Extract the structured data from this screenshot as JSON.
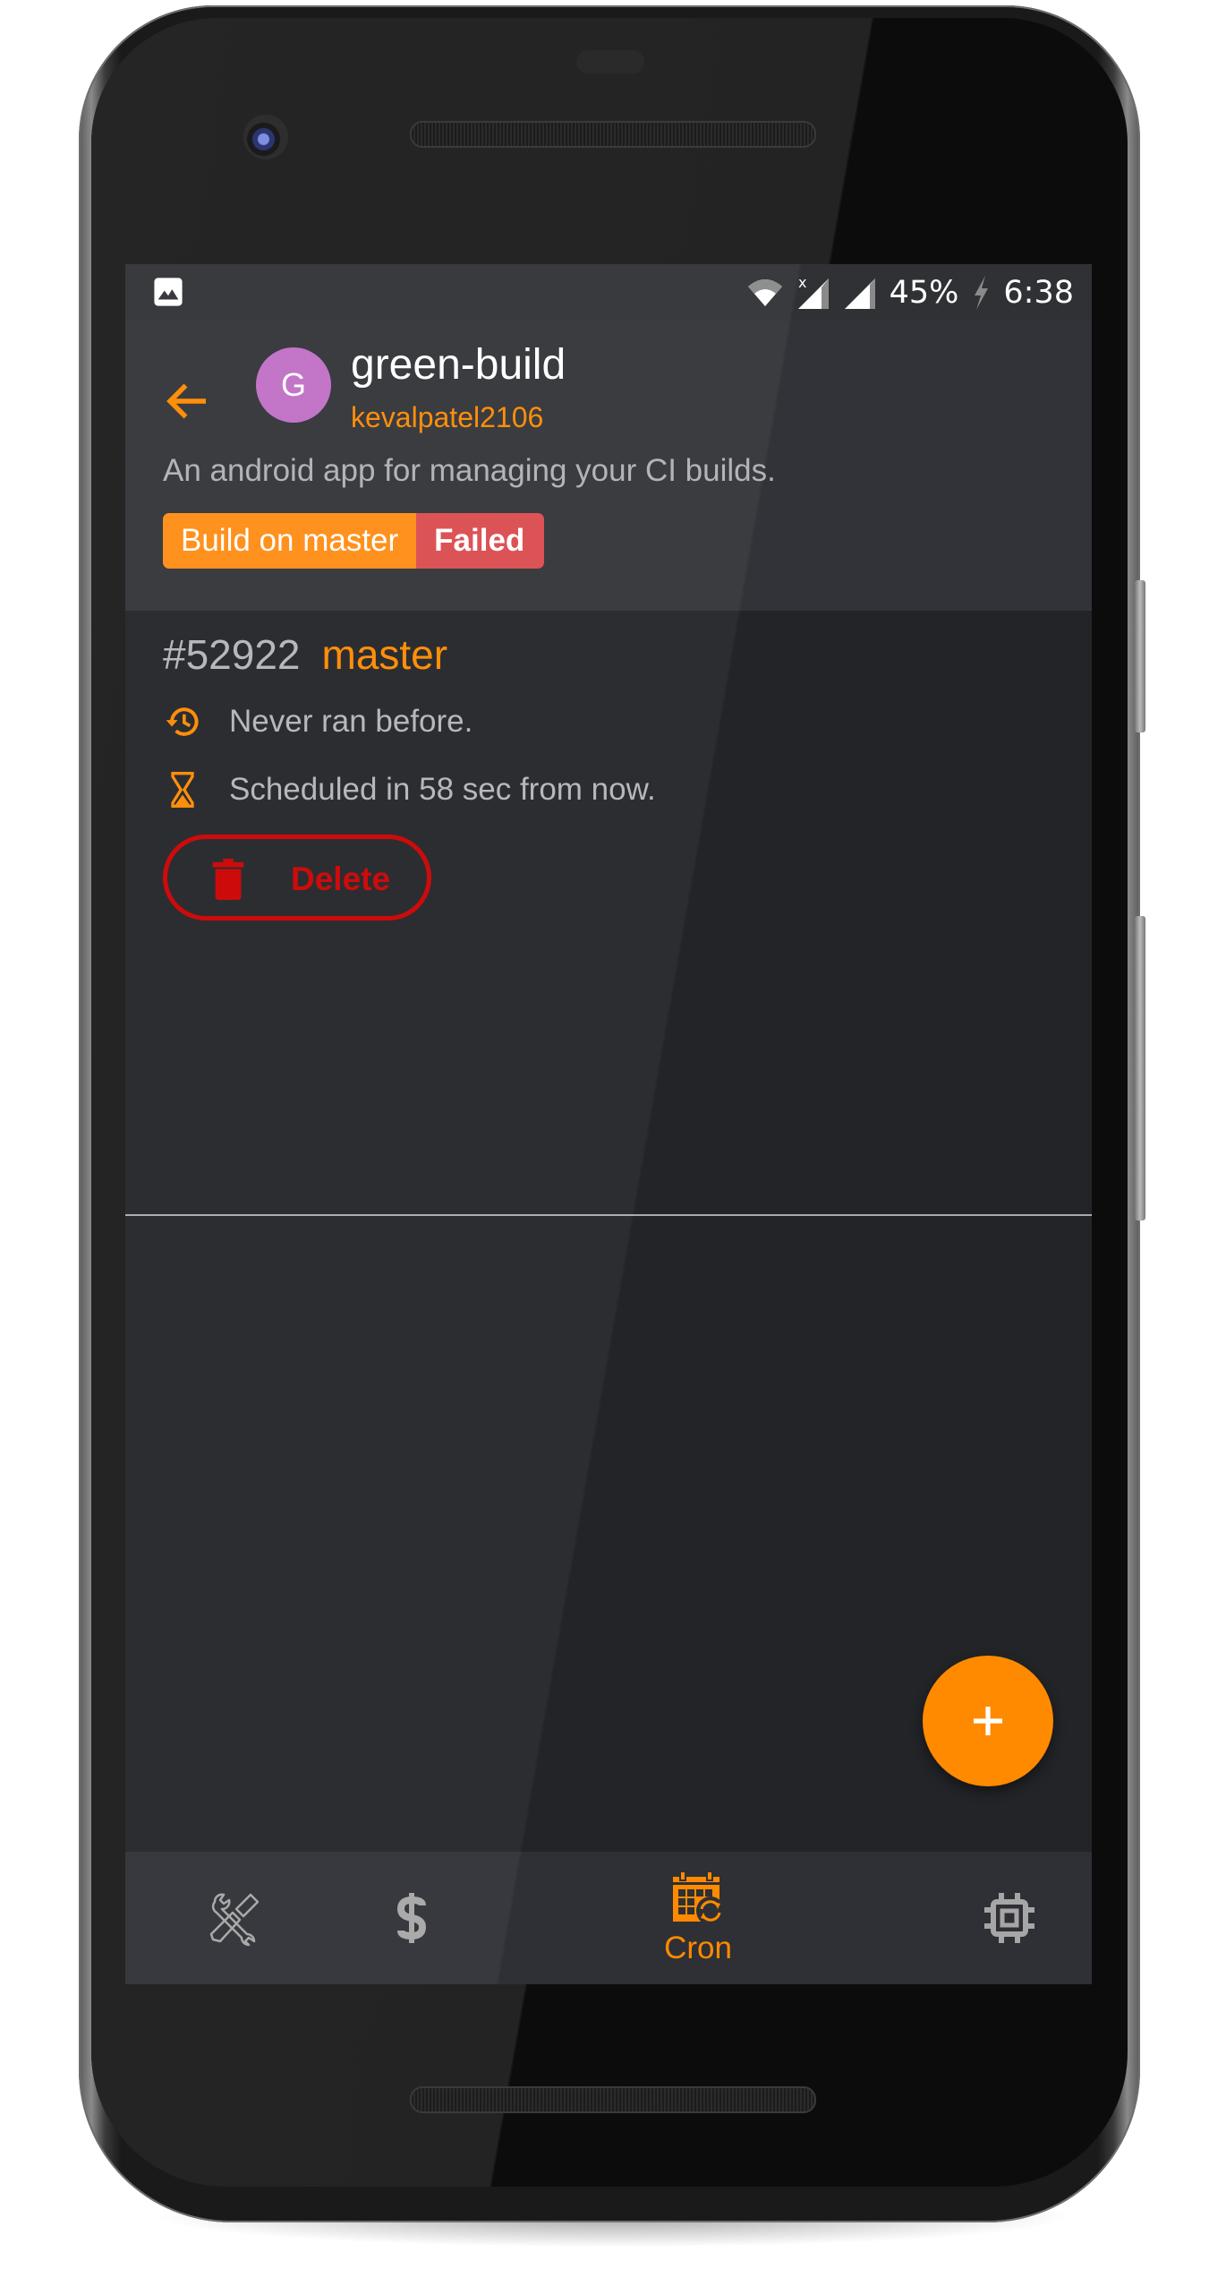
{
  "status_bar": {
    "left_icons": [
      "gallery-icon"
    ],
    "right_icons": [
      "wifi-icon",
      "signal-no-data-icon",
      "signal-icon"
    ],
    "battery_percent": "45%",
    "battery_icon": "charging-bolt-icon",
    "time": "6:38"
  },
  "header": {
    "back_icon": "arrow-left-icon",
    "avatar_letter": "G",
    "repo_name": "green-build",
    "owner": "kevalpatel2106",
    "description": "An android app for managing your CI builds.",
    "badge": {
      "label": "Build on master",
      "status": "Failed"
    }
  },
  "cron_item": {
    "number": "#52922",
    "branch": "master",
    "last_run": {
      "icon": "history-icon",
      "text": "Never ran before."
    },
    "next_run": {
      "icon": "hourglass-icon",
      "text": "Scheduled in 58 sec from now."
    },
    "delete_label": "Delete"
  },
  "fab": {
    "icon": "plus-icon"
  },
  "bottom_nav": {
    "items": [
      {
        "id": "tools",
        "icon": "wrench-screwdriver-icon",
        "label": "",
        "active": false
      },
      {
        "id": "billing",
        "icon": "dollar-icon",
        "label": "",
        "active": false
      },
      {
        "id": "cron",
        "icon": "calendar-sync-icon",
        "label": "Cron",
        "active": true
      },
      {
        "id": "system",
        "icon": "chip-icon",
        "label": "",
        "active": false
      }
    ]
  },
  "colors": {
    "accent": "#ff8a00",
    "danger": "#cc0000",
    "failed_badge": "#db4b4f",
    "avatar": "#c06fc6",
    "background": "#222428",
    "header_bg": "#313338",
    "nav_bg": "#2e3035",
    "icon_inactive": "#a6a6a6"
  }
}
